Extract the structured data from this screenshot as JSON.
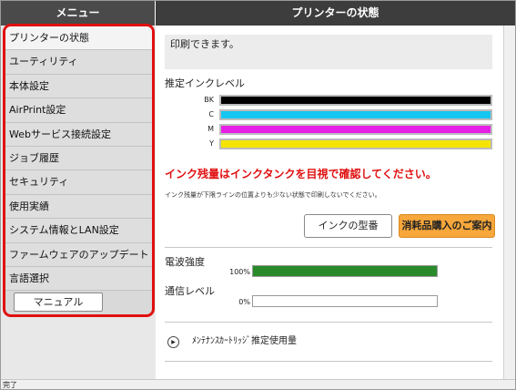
{
  "header": {
    "menu_title": "メニュー",
    "page_title": "プリンターの状態"
  },
  "sidebar": {
    "items": [
      {
        "label": "プリンターの状態",
        "active": true
      },
      {
        "label": "ユーティリティ",
        "active": false
      },
      {
        "label": "本体設定",
        "active": false
      },
      {
        "label": "AirPrint設定",
        "active": false
      },
      {
        "label": "Webサービス接続設定",
        "active": false
      },
      {
        "label": "ジョブ履歴",
        "active": false
      },
      {
        "label": "セキュリティ",
        "active": false
      },
      {
        "label": "使用実績",
        "active": false
      },
      {
        "label": "システム情報とLAN設定",
        "active": false
      },
      {
        "label": "ファームウェアのアップデート",
        "active": false
      },
      {
        "label": "言語選択",
        "active": false
      }
    ],
    "manual_button": "マニュアル"
  },
  "main": {
    "status_message": "印刷できます。",
    "ink_title": "推定インクレベル",
    "inks": [
      {
        "label": "BK",
        "color": "#000000"
      },
      {
        "label": "C",
        "color": "#15c7f0"
      },
      {
        "label": "M",
        "color": "#e61fe6"
      },
      {
        "label": "Y",
        "color": "#f5e400"
      }
    ],
    "warning_red": "インク残量はインクタンクを目視で確認してください。",
    "warning_small": "インク残量が下限ラインの位置よりも少ない状態で印刷しないでください。",
    "ink_model_button": "インクの型番",
    "supplies_button": "消耗品購入のご案内",
    "signal_title": "電波強度",
    "signal_value": "100%",
    "signal_level": 1.0,
    "comm_title": "通信レベル",
    "comm_value": "0%",
    "comm_level": 0.0,
    "maintenance_label": "ﾒﾝﾃﾅﾝｽｶｰﾄﾘｯｼﾞ推定使用量"
  },
  "statusbar": {
    "text": "完了"
  },
  "colors": {
    "accent_red": "#e01010",
    "supplies_orange": "#f7a73b",
    "signal_green": "#2a8a2a"
  }
}
